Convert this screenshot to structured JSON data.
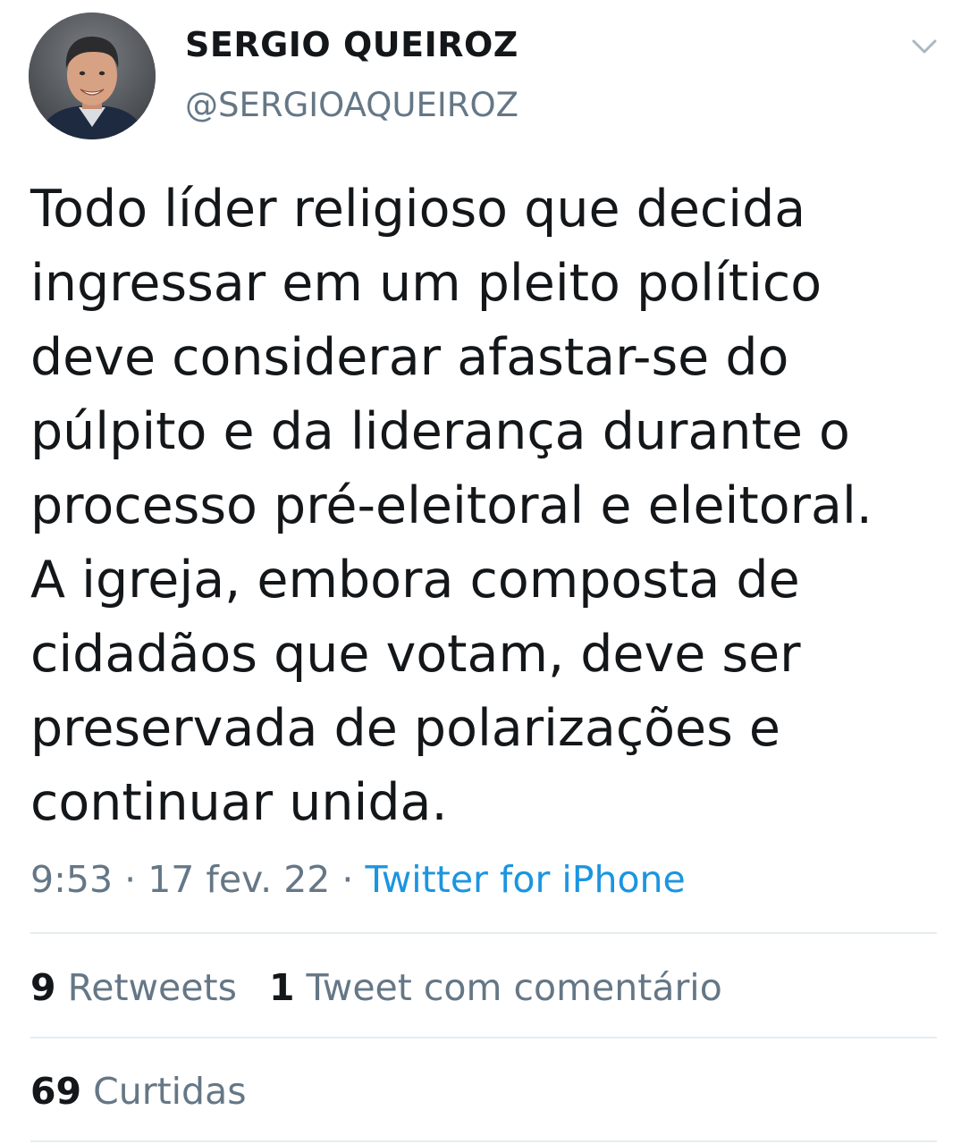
{
  "author": {
    "display_name": "SERGIO QUEIROZ",
    "handle": "@SERGIOAQUEIROZ",
    "avatar_icon": "profile-photo"
  },
  "menu_icon": "chevron-down-icon",
  "tweet": {
    "text": "Todo líder religioso que decida\ningressar em um pleito político\ndeve considerar afastar-se do\npúlpito e da liderança  durante o\nprocesso pré-eleitoral e eleitoral.\nA igreja, embora composta de\ncidadãos que votam, deve ser\npreservada de polarizações e\ncontinuar unida.",
    "time": "9:53",
    "separator": " · ",
    "date": "17 fev. 22",
    "source": "Twitter for iPhone"
  },
  "stats": {
    "retweets_count": "9",
    "retweets_label": "Retweets",
    "quotes_count": "1",
    "quotes_label": "Tweet com comentário",
    "likes_count": "69",
    "likes_label": "Curtidas"
  },
  "colors": {
    "text": "#14171a",
    "muted": "#657786",
    "link": "#1b95e0",
    "divider": "#e6ecf0"
  }
}
